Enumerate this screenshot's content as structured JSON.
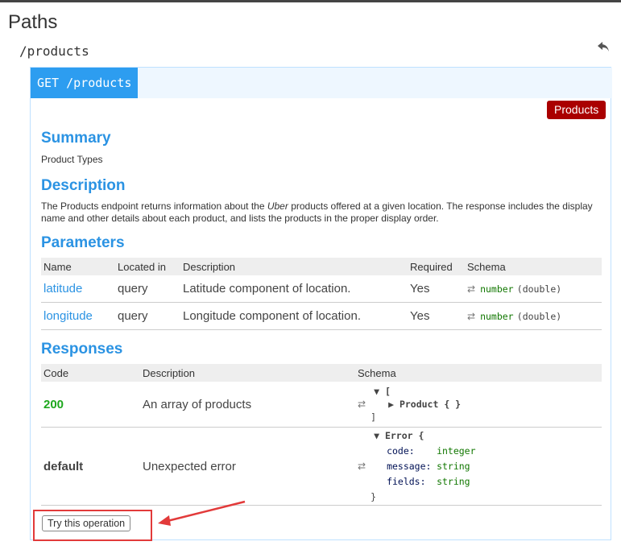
{
  "paths": {
    "title": "Paths",
    "path": "/products"
  },
  "operation": {
    "method_path": "GET /products",
    "tag": "Products",
    "summary_heading": "Summary",
    "summary": "Product Types",
    "description_heading": "Description",
    "description_before": "The Products endpoint returns information about the ",
    "description_em": "Uber",
    "description_after": " products offered at a given location. The response includes the display name and other details about each product, and lists the products in the proper display order.",
    "parameters_heading": "Parameters",
    "parameters_columns": [
      "Name",
      "Located in",
      "Description",
      "Required",
      "Schema"
    ],
    "parameters": [
      {
        "name": "latitude",
        "in": "query",
        "description": "Latitude component of location.",
        "required": "Yes",
        "type": "number",
        "format": "(double)"
      },
      {
        "name": "longitude",
        "in": "query",
        "description": "Longitude component of location.",
        "required": "Yes",
        "type": "number",
        "format": "(double)"
      }
    ],
    "responses_heading": "Responses",
    "responses_columns": [
      "Code",
      "Description",
      "Schema"
    ],
    "responses": [
      {
        "code": "200",
        "description": "An array of products",
        "schema_open": "[",
        "schema_item": "Product { }",
        "schema_close": "]"
      },
      {
        "code": "default",
        "description": "Unexpected error",
        "schema_title": "Error {",
        "fields": [
          {
            "k": "code:",
            "v": "integer"
          },
          {
            "k": "message:",
            "v": "string"
          },
          {
            "k": "fields:",
            "v": "string"
          }
        ],
        "schema_close": "}"
      }
    ],
    "try_button": "Try this operation"
  },
  "colors": {
    "accent": "#2d9df0",
    "tag": "#aa0000",
    "success": "#1ea81e",
    "annotation": "#e23a3a"
  },
  "icons": {
    "back": "reply-arrow-icon",
    "swap": "swap-arrows-icon",
    "expand": "triangle-down-icon",
    "collapsed": "triangle-right-icon"
  }
}
